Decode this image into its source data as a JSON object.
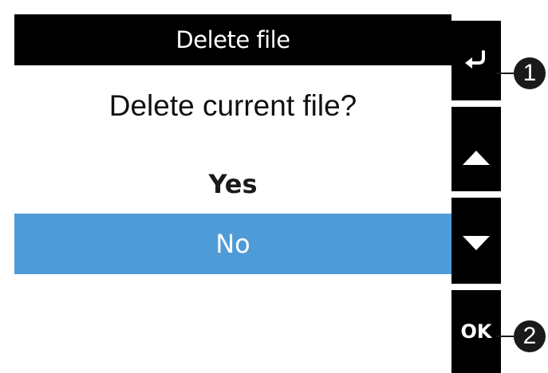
{
  "dialog": {
    "title": "Delete file",
    "question": "Delete current file?",
    "options": [
      "Yes",
      "No"
    ],
    "selected_option": "No"
  },
  "keys": {
    "back_icon": "return-arrow-icon",
    "up_icon": "triangle-up-icon",
    "down_icon": "triangle-down-icon",
    "ok_label": "OK"
  },
  "callouts": [
    "1",
    "2"
  ],
  "colors": {
    "title_bar": "#000000",
    "selected_row": "#4f9bd8",
    "key_column": "#000000",
    "callout": "#1a1a1a"
  }
}
